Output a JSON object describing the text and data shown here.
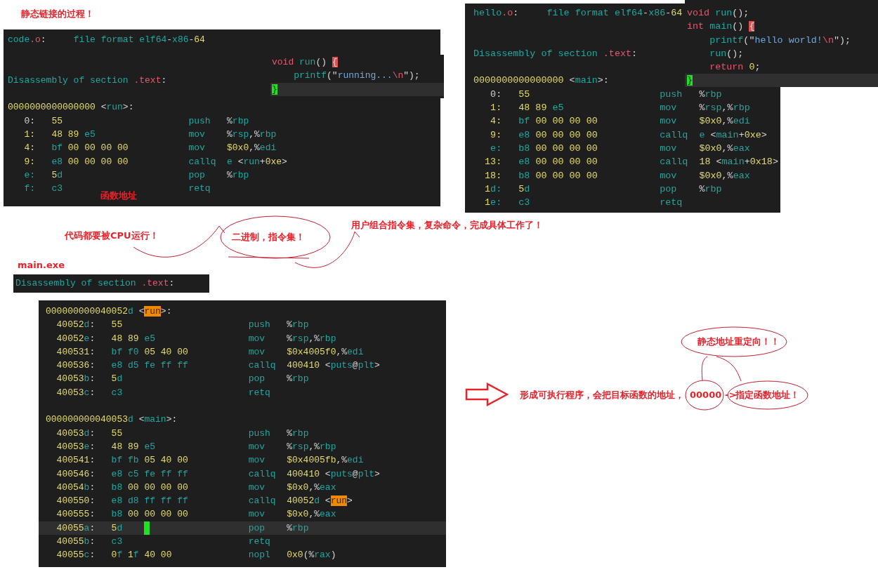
{
  "notes": [
    {
      "text": "静态链接的过程！"
    },
    {
      "text": "函数地址"
    },
    {
      "text": "代码都要被CPU运行！"
    },
    {
      "text": "二进制，指令集！"
    },
    {
      "text": "用户组合指令集，复杂命令，完成具体工作了！"
    },
    {
      "text": "main.exe"
    },
    {
      "text": "静态地址重定向！！"
    },
    {
      "text": "形成可执行程序，会把目标函数的地址，"
    },
    {
      "text": "00000"
    },
    {
      "text": "->"
    },
    {
      "text": "指定函数地址！"
    }
  ],
  "panels": [
    {
      "lines": [
        {
          "kind": "text",
          "current": false,
          "segs": [
            {
              "kind": "name",
              "text": "code"
            },
            {
              "kind": "kw",
              "text": ".o"
            },
            {
              "kind": "plain",
              "text": ":     "
            },
            {
              "kind": "name",
              "text": "file format elf64"
            },
            {
              "kind": "plain",
              "text": "-"
            },
            {
              "kind": "name",
              "text": "x86"
            },
            {
              "kind": "plain",
              "text": "-"
            },
            {
              "kind": "num",
              "text": "64"
            }
          ]
        },
        {
          "kind": "blank",
          "current": false
        },
        {
          "kind": "blank",
          "current": false
        },
        {
          "kind": "text",
          "current": false,
          "segs": [
            {
              "kind": "name",
              "text": "Disassembly of section "
            },
            {
              "kind": "kw",
              "text": ".text"
            },
            {
              "kind": "plain",
              "text": ":"
            }
          ]
        },
        {
          "kind": "blank",
          "current": false
        },
        {
          "kind": "text",
          "current": false,
          "segs": [
            {
              "kind": "num",
              "text": "0000000000000000"
            },
            {
              "kind": "plain",
              "text": " <"
            },
            {
              "kind": "name",
              "text": "run"
            },
            {
              "kind": "plain",
              "text": ">:"
            }
          ]
        },
        {
          "kind": "insn",
          "current": false,
          "cursor": false,
          "addr": [
            {
              "kind": "plain",
              "text": "0:"
            }
          ],
          "bytes": [
            {
              "kind": "num",
              "text": "55"
            }
          ],
          "mnemonic": "push",
          "operands": [
            {
              "kind": "plain",
              "text": "%"
            },
            {
              "kind": "name",
              "text": "rbp"
            }
          ]
        },
        {
          "kind": "insn",
          "current": false,
          "cursor": false,
          "addr": [
            {
              "kind": "num",
              "text": "1:"
            }
          ],
          "bytes": [
            {
              "kind": "num",
              "text": "48 89 "
            },
            {
              "kind": "name",
              "text": "e5"
            }
          ],
          "mnemonic": "mov",
          "operands": [
            {
              "kind": "plain",
              "text": "%"
            },
            {
              "kind": "name",
              "text": "rsp"
            },
            {
              "kind": "plain",
              "text": ",%"
            },
            {
              "kind": "name",
              "text": "rbp"
            }
          ]
        },
        {
          "kind": "insn",
          "current": false,
          "cursor": false,
          "addr": [
            {
              "kind": "num",
              "text": "4:"
            }
          ],
          "bytes": [
            {
              "kind": "name",
              "text": "bf "
            },
            {
              "kind": "num",
              "text": "00 00 00 00"
            }
          ],
          "mnemonic": "mov",
          "operands": [
            {
              "kind": "num",
              "text": "$0x0"
            },
            {
              "kind": "plain",
              "text": ",%"
            },
            {
              "kind": "name",
              "text": "edi"
            }
          ]
        },
        {
          "kind": "insn",
          "current": false,
          "cursor": false,
          "addr": [
            {
              "kind": "num",
              "text": "9:"
            }
          ],
          "bytes": [
            {
              "kind": "name",
              "text": "e8 "
            },
            {
              "kind": "num",
              "text": "00 00 00 00"
            }
          ],
          "mnemonic": "callq",
          "operands": [
            {
              "kind": "name",
              "text": "e "
            },
            {
              "kind": "plain",
              "text": "<"
            },
            {
              "kind": "name",
              "text": "run"
            },
            {
              "kind": "plain",
              "text": "+"
            },
            {
              "kind": "num",
              "text": "0xe"
            },
            {
              "kind": "plain",
              "text": ">"
            }
          ]
        },
        {
          "kind": "insn",
          "current": false,
          "cursor": false,
          "addr": [
            {
              "kind": "name",
              "text": "e:"
            }
          ],
          "bytes": [
            {
              "kind": "num",
              "text": "5"
            },
            {
              "kind": "name",
              "text": "d"
            }
          ],
          "mnemonic": "pop",
          "operands": [
            {
              "kind": "plain",
              "text": "%"
            },
            {
              "kind": "name",
              "text": "rbp"
            }
          ]
        },
        {
          "kind": "insn",
          "current": false,
          "cursor": false,
          "addr": [
            {
              "kind": "name",
              "text": "f:"
            }
          ],
          "bytes": [
            {
              "kind": "name",
              "text": "c3"
            }
          ],
          "mnemonic": "retq"
        }
      ]
    },
    {
      "lines": [
        {
          "kind": "text",
          "current": false,
          "segs": [
            {
              "kind": "kw",
              "text": "void "
            },
            {
              "kind": "name",
              "text": "run"
            },
            {
              "kind": "plain",
              "text": "() "
            },
            {
              "kind": "brace",
              "text": "{"
            }
          ]
        },
        {
          "kind": "indented",
          "current": false,
          "segs": [
            {
              "kind": "name",
              "text": "printf"
            },
            {
              "kind": "plain",
              "text": "(\""
            },
            {
              "kind": "str",
              "text": "running..."
            },
            {
              "kind": "kw",
              "text": "\\n"
            },
            {
              "kind": "plain",
              "text": "\");"
            }
          ]
        },
        {
          "kind": "text",
          "current": true,
          "segs": [
            {
              "kind": "cursor-brace",
              "text": "}"
            }
          ]
        }
      ]
    },
    {
      "lines": [
        {
          "kind": "text",
          "current": false,
          "segs": [
            {
              "kind": "name",
              "text": "hello"
            },
            {
              "kind": "kw",
              "text": ".o"
            },
            {
              "kind": "plain",
              "text": ":     "
            },
            {
              "kind": "name",
              "text": "file format elf64"
            },
            {
              "kind": "plain",
              "text": "-"
            },
            {
              "kind": "name",
              "text": "x86"
            },
            {
              "kind": "plain",
              "text": "-"
            },
            {
              "kind": "num",
              "text": "64"
            }
          ]
        },
        {
          "kind": "blank",
          "current": false
        },
        {
          "kind": "blank",
          "current": false
        },
        {
          "kind": "text",
          "current": false,
          "segs": [
            {
              "kind": "name",
              "text": "Disassembly of section "
            },
            {
              "kind": "kw",
              "text": ".text"
            },
            {
              "kind": "plain",
              "text": ":"
            }
          ]
        },
        {
          "kind": "blank",
          "current": false
        },
        {
          "kind": "text",
          "current": false,
          "segs": [
            {
              "kind": "num",
              "text": "0000000000000000"
            },
            {
              "kind": "plain",
              "text": " <"
            },
            {
              "kind": "name",
              "text": "main"
            },
            {
              "kind": "plain",
              "text": ">:"
            }
          ]
        },
        {
          "kind": "insn",
          "current": false,
          "cursor": false,
          "addr": [
            {
              "kind": "plain",
              "text": "0:"
            }
          ],
          "bytes": [
            {
              "kind": "num",
              "text": "55"
            }
          ],
          "mnemonic": "push",
          "operands": [
            {
              "kind": "plain",
              "text": "%"
            },
            {
              "kind": "name",
              "text": "rbp"
            }
          ]
        },
        {
          "kind": "insn",
          "current": false,
          "cursor": false,
          "addr": [
            {
              "kind": "num",
              "text": "1:"
            }
          ],
          "bytes": [
            {
              "kind": "num",
              "text": "48 89 "
            },
            {
              "kind": "name",
              "text": "e5"
            }
          ],
          "mnemonic": "mov",
          "operands": [
            {
              "kind": "plain",
              "text": "%"
            },
            {
              "kind": "name",
              "text": "rsp"
            },
            {
              "kind": "plain",
              "text": ",%"
            },
            {
              "kind": "name",
              "text": "rbp"
            }
          ]
        },
        {
          "kind": "insn",
          "current": false,
          "cursor": false,
          "addr": [
            {
              "kind": "num",
              "text": "4:"
            }
          ],
          "bytes": [
            {
              "kind": "name",
              "text": "bf "
            },
            {
              "kind": "num",
              "text": "00 00 00 00"
            }
          ],
          "mnemonic": "mov",
          "operands": [
            {
              "kind": "num",
              "text": "$0x0"
            },
            {
              "kind": "plain",
              "text": ",%"
            },
            {
              "kind": "name",
              "text": "edi"
            }
          ]
        },
        {
          "kind": "insn",
          "current": false,
          "cursor": false,
          "addr": [
            {
              "kind": "num",
              "text": "9:"
            }
          ],
          "bytes": [
            {
              "kind": "name",
              "text": "e8 "
            },
            {
              "kind": "num",
              "text": "00 00 00 00"
            }
          ],
          "mnemonic": "callq",
          "operands": [
            {
              "kind": "name",
              "text": "e "
            },
            {
              "kind": "plain",
              "text": "<"
            },
            {
              "kind": "name",
              "text": "main"
            },
            {
              "kind": "plain",
              "text": "+"
            },
            {
              "kind": "num",
              "text": "0xe"
            },
            {
              "kind": "plain",
              "text": ">"
            }
          ]
        },
        {
          "kind": "insn",
          "current": false,
          "cursor": false,
          "addr": [
            {
              "kind": "name",
              "text": "e:"
            }
          ],
          "bytes": [
            {
              "kind": "name",
              "text": "b8 "
            },
            {
              "kind": "num",
              "text": "00 00 00 00"
            }
          ],
          "mnemonic": "mov",
          "operands": [
            {
              "kind": "num",
              "text": "$0x0"
            },
            {
              "kind": "plain",
              "text": ",%"
            },
            {
              "kind": "name",
              "text": "eax"
            }
          ]
        },
        {
          "kind": "insn",
          "current": false,
          "cursor": false,
          "addr": [
            {
              "kind": "num",
              "text": "13:"
            }
          ],
          "bytes": [
            {
              "kind": "name",
              "text": "e8 "
            },
            {
              "kind": "num",
              "text": "00 00 00 00"
            }
          ],
          "mnemonic": "callq",
          "operands": [
            {
              "kind": "num",
              "text": "18 "
            },
            {
              "kind": "plain",
              "text": "<"
            },
            {
              "kind": "name",
              "text": "main"
            },
            {
              "kind": "plain",
              "text": "+"
            },
            {
              "kind": "num",
              "text": "0x18"
            },
            {
              "kind": "plain",
              "text": ">"
            }
          ]
        },
        {
          "kind": "insn",
          "current": false,
          "cursor": false,
          "addr": [
            {
              "kind": "num",
              "text": "18:"
            }
          ],
          "bytes": [
            {
              "kind": "name",
              "text": "b8 "
            },
            {
              "kind": "num",
              "text": "00 00 00 00"
            }
          ],
          "mnemonic": "mov",
          "operands": [
            {
              "kind": "num",
              "text": "$0x0"
            },
            {
              "kind": "plain",
              "text": ",%"
            },
            {
              "kind": "name",
              "text": "eax"
            }
          ]
        },
        {
          "kind": "insn",
          "current": false,
          "cursor": false,
          "addr": [
            {
              "kind": "num",
              "text": "1"
            },
            {
              "kind": "name",
              "text": "d:"
            }
          ],
          "bytes": [
            {
              "kind": "num",
              "text": "5"
            },
            {
              "kind": "name",
              "text": "d"
            }
          ],
          "mnemonic": "pop",
          "operands": [
            {
              "kind": "plain",
              "text": "%"
            },
            {
              "kind": "name",
              "text": "rbp"
            }
          ]
        },
        {
          "kind": "insn",
          "current": false,
          "cursor": false,
          "addr": [
            {
              "kind": "num",
              "text": "1"
            },
            {
              "kind": "name",
              "text": "e:"
            }
          ],
          "bytes": [
            {
              "kind": "name",
              "text": "c3"
            }
          ],
          "mnemonic": "retq"
        }
      ]
    },
    {
      "lines": [
        {
          "kind": "text",
          "current": false,
          "segs": [
            {
              "kind": "kw",
              "text": "void "
            },
            {
              "kind": "name",
              "text": "run"
            },
            {
              "kind": "plain",
              "text": "();"
            }
          ]
        },
        {
          "kind": "text",
          "current": false,
          "segs": [
            {
              "kind": "kw",
              "text": "int "
            },
            {
              "kind": "name",
              "text": "main"
            },
            {
              "kind": "plain",
              "text": "() "
            },
            {
              "kind": "brace",
              "text": "{"
            }
          ]
        },
        {
          "kind": "indented",
          "current": false,
          "segs": [
            {
              "kind": "name",
              "text": "printf"
            },
            {
              "kind": "plain",
              "text": "(\""
            },
            {
              "kind": "str",
              "text": "hello world!"
            },
            {
              "kind": "kw",
              "text": "\\n"
            },
            {
              "kind": "plain",
              "text": "\");"
            }
          ]
        },
        {
          "kind": "indented",
          "current": false,
          "segs": [
            {
              "kind": "name",
              "text": "run"
            },
            {
              "kind": "plain",
              "text": "();"
            }
          ]
        },
        {
          "kind": "indented",
          "current": false,
          "segs": [
            {
              "kind": "kw",
              "text": "return "
            },
            {
              "kind": "num",
              "text": "0"
            },
            {
              "kind": "plain",
              "text": ";"
            }
          ]
        },
        {
          "kind": "text",
          "current": true,
          "segs": [
            {
              "kind": "cursor-brace",
              "text": "}"
            }
          ]
        }
      ]
    },
    {
      "lines": [
        {
          "kind": "text",
          "current": false,
          "segs": [
            {
              "kind": "name",
              "text": "Disassembly of section "
            },
            {
              "kind": "kw",
              "text": ".text"
            },
            {
              "kind": "plain",
              "text": ":"
            }
          ]
        }
      ]
    },
    {
      "lines": [
        {
          "kind": "text",
          "current": false,
          "segs": [
            {
              "kind": "num",
              "text": "000000000040052"
            },
            {
              "kind": "name",
              "text": "d"
            },
            {
              "kind": "plain",
              "text": " <"
            },
            {
              "kind": "match",
              "text": "run"
            },
            {
              "kind": "plain",
              "text": ">:"
            }
          ]
        },
        {
          "kind": "insn",
          "current": false,
          "cursor": false,
          "addr": [
            {
              "kind": "num",
              "text": "40052"
            },
            {
              "kind": "name",
              "text": "d"
            },
            {
              "kind": "plain",
              "text": ":"
            }
          ],
          "bytes": [
            {
              "kind": "num",
              "text": "55"
            }
          ],
          "mnemonic": "push",
          "operands": [
            {
              "kind": "plain",
              "text": "%"
            },
            {
              "kind": "name",
              "text": "rbp"
            }
          ]
        },
        {
          "kind": "insn",
          "current": false,
          "cursor": false,
          "addr": [
            {
              "kind": "num",
              "text": "40052"
            },
            {
              "kind": "name",
              "text": "e"
            },
            {
              "kind": "plain",
              "text": ":"
            }
          ],
          "bytes": [
            {
              "kind": "num",
              "text": "48 89 "
            },
            {
              "kind": "name",
              "text": "e5"
            }
          ],
          "mnemonic": "mov",
          "operands": [
            {
              "kind": "plain",
              "text": "%"
            },
            {
              "kind": "name",
              "text": "rsp"
            },
            {
              "kind": "plain",
              "text": ",%"
            },
            {
              "kind": "name",
              "text": "rbp"
            }
          ]
        },
        {
          "kind": "insn",
          "current": false,
          "cursor": false,
          "addr": [
            {
              "kind": "num",
              "text": "400531"
            },
            {
              "kind": "plain",
              "text": ":"
            }
          ],
          "bytes": [
            {
              "kind": "name",
              "text": "bf f0 "
            },
            {
              "kind": "num",
              "text": "05 40 00"
            }
          ],
          "mnemonic": "mov",
          "operands": [
            {
              "kind": "num",
              "text": "$0x4005f0"
            },
            {
              "kind": "plain",
              "text": ",%"
            },
            {
              "kind": "name",
              "text": "edi"
            }
          ]
        },
        {
          "kind": "insn",
          "current": false,
          "cursor": false,
          "addr": [
            {
              "kind": "num",
              "text": "400536"
            },
            {
              "kind": "plain",
              "text": ":"
            }
          ],
          "bytes": [
            {
              "kind": "name",
              "text": "e8 d5 fe ff ff"
            }
          ],
          "mnemonic": "callq",
          "operands": [
            {
              "kind": "num",
              "text": "400410 "
            },
            {
              "kind": "plain",
              "text": "<"
            },
            {
              "kind": "name",
              "text": "puts"
            },
            {
              "kind": "plain",
              "text": "@"
            },
            {
              "kind": "name",
              "text": "plt"
            },
            {
              "kind": "plain",
              "text": ">"
            }
          ]
        },
        {
          "kind": "insn",
          "current": false,
          "cursor": false,
          "addr": [
            {
              "kind": "num",
              "text": "40053"
            },
            {
              "kind": "name",
              "text": "b"
            },
            {
              "kind": "plain",
              "text": ":"
            }
          ],
          "bytes": [
            {
              "kind": "num",
              "text": "5"
            },
            {
              "kind": "name",
              "text": "d"
            }
          ],
          "mnemonic": "pop",
          "operands": [
            {
              "kind": "plain",
              "text": "%"
            },
            {
              "kind": "name",
              "text": "rbp"
            }
          ]
        },
        {
          "kind": "insn",
          "current": false,
          "cursor": false,
          "addr": [
            {
              "kind": "num",
              "text": "40053"
            },
            {
              "kind": "name",
              "text": "c"
            },
            {
              "kind": "plain",
              "text": ":"
            }
          ],
          "bytes": [
            {
              "kind": "name",
              "text": "c3"
            }
          ],
          "mnemonic": "retq"
        },
        {
          "kind": "blank",
          "current": false
        },
        {
          "kind": "text",
          "current": false,
          "segs": [
            {
              "kind": "num",
              "text": "000000000040053"
            },
            {
              "kind": "name",
              "text": "d"
            },
            {
              "kind": "plain",
              "text": " <"
            },
            {
              "kind": "name",
              "text": "main"
            },
            {
              "kind": "plain",
              "text": ">:"
            }
          ]
        },
        {
          "kind": "insn",
          "current": false,
          "cursor": false,
          "addr": [
            {
              "kind": "num",
              "text": "40053"
            },
            {
              "kind": "name",
              "text": "d"
            },
            {
              "kind": "plain",
              "text": ":"
            }
          ],
          "bytes": [
            {
              "kind": "num",
              "text": "55"
            }
          ],
          "mnemonic": "push",
          "operands": [
            {
              "kind": "plain",
              "text": "%"
            },
            {
              "kind": "name",
              "text": "rbp"
            }
          ]
        },
        {
          "kind": "insn",
          "current": false,
          "cursor": false,
          "addr": [
            {
              "kind": "num",
              "text": "40053"
            },
            {
              "kind": "name",
              "text": "e"
            },
            {
              "kind": "plain",
              "text": ":"
            }
          ],
          "bytes": [
            {
              "kind": "num",
              "text": "48 89 "
            },
            {
              "kind": "name",
              "text": "e5"
            }
          ],
          "mnemonic": "mov",
          "operands": [
            {
              "kind": "plain",
              "text": "%"
            },
            {
              "kind": "name",
              "text": "rsp"
            },
            {
              "kind": "plain",
              "text": ",%"
            },
            {
              "kind": "name",
              "text": "rbp"
            }
          ]
        },
        {
          "kind": "insn",
          "current": false,
          "cursor": false,
          "addr": [
            {
              "kind": "num",
              "text": "400541"
            },
            {
              "kind": "plain",
              "text": ":"
            }
          ],
          "bytes": [
            {
              "kind": "name",
              "text": "bf fb "
            },
            {
              "kind": "num",
              "text": "05 40 00"
            }
          ],
          "mnemonic": "mov",
          "operands": [
            {
              "kind": "num",
              "text": "$0x4005fb"
            },
            {
              "kind": "plain",
              "text": ",%"
            },
            {
              "kind": "name",
              "text": "edi"
            }
          ]
        },
        {
          "kind": "insn",
          "current": false,
          "cursor": false,
          "addr": [
            {
              "kind": "num",
              "text": "400546"
            },
            {
              "kind": "plain",
              "text": ":"
            }
          ],
          "bytes": [
            {
              "kind": "name",
              "text": "e8 c5 fe ff ff"
            }
          ],
          "mnemonic": "callq",
          "operands": [
            {
              "kind": "num",
              "text": "400410 "
            },
            {
              "kind": "plain",
              "text": "<"
            },
            {
              "kind": "name",
              "text": "puts"
            },
            {
              "kind": "plain",
              "text": "@"
            },
            {
              "kind": "name",
              "text": "plt"
            },
            {
              "kind": "plain",
              "text": ">"
            }
          ]
        },
        {
          "kind": "insn",
          "current": false,
          "cursor": false,
          "addr": [
            {
              "kind": "num",
              "text": "40054"
            },
            {
              "kind": "name",
              "text": "b"
            },
            {
              "kind": "plain",
              "text": ":"
            }
          ],
          "bytes": [
            {
              "kind": "name",
              "text": "b8 "
            },
            {
              "kind": "num",
              "text": "00 00 00 00"
            }
          ],
          "mnemonic": "mov",
          "operands": [
            {
              "kind": "num",
              "text": "$0x0"
            },
            {
              "kind": "plain",
              "text": ",%"
            },
            {
              "kind": "name",
              "text": "eax"
            }
          ]
        },
        {
          "kind": "insn",
          "current": false,
          "cursor": false,
          "addr": [
            {
              "kind": "num",
              "text": "400550"
            },
            {
              "kind": "plain",
              "text": ":"
            }
          ],
          "bytes": [
            {
              "kind": "name",
              "text": "e8 d8 ff ff ff"
            }
          ],
          "mnemonic": "callq",
          "operands": [
            {
              "kind": "num",
              "text": "40052"
            },
            {
              "kind": "name",
              "text": "d"
            },
            {
              "kind": "plain",
              "text": " <"
            },
            {
              "kind": "match",
              "text": "run"
            },
            {
              "kind": "plain",
              "text": ">"
            }
          ]
        },
        {
          "kind": "insn",
          "current": false,
          "cursor": false,
          "addr": [
            {
              "kind": "num",
              "text": "400555"
            },
            {
              "kind": "plain",
              "text": ":"
            }
          ],
          "bytes": [
            {
              "kind": "name",
              "text": "b8 "
            },
            {
              "kind": "num",
              "text": "00 00 00 00"
            }
          ],
          "mnemonic": "mov",
          "operands": [
            {
              "kind": "num",
              "text": "$0x0"
            },
            {
              "kind": "plain",
              "text": ",%"
            },
            {
              "kind": "name",
              "text": "eax"
            }
          ]
        },
        {
          "kind": "insn",
          "current": true,
          "cursor": true,
          "addr": [
            {
              "kind": "num",
              "text": "40055"
            },
            {
              "kind": "name",
              "text": "a"
            },
            {
              "kind": "plain",
              "text": ":"
            }
          ],
          "bytes": [
            {
              "kind": "num",
              "text": "5"
            },
            {
              "kind": "name",
              "text": "d"
            }
          ],
          "mnemonic": "pop",
          "operands": [
            {
              "kind": "plain",
              "text": "%"
            },
            {
              "kind": "name",
              "text": "rbp"
            }
          ]
        },
        {
          "kind": "insn",
          "current": false,
          "cursor": false,
          "addr": [
            {
              "kind": "num",
              "text": "40055"
            },
            {
              "kind": "name",
              "text": "b"
            },
            {
              "kind": "plain",
              "text": ":"
            }
          ],
          "bytes": [
            {
              "kind": "name",
              "text": "c3"
            }
          ],
          "mnemonic": "retq"
        },
        {
          "kind": "insn",
          "current": false,
          "cursor": false,
          "addr": [
            {
              "kind": "num",
              "text": "40055"
            },
            {
              "kind": "name",
              "text": "c"
            },
            {
              "kind": "plain",
              "text": ":"
            }
          ],
          "bytes": [
            {
              "kind": "num",
              "text": "0"
            },
            {
              "kind": "name",
              "text": "f "
            },
            {
              "kind": "num",
              "text": "1"
            },
            {
              "kind": "name",
              "text": "f "
            },
            {
              "kind": "num",
              "text": "40 00"
            }
          ],
          "mnemonic": "nopl",
          "operands": [
            {
              "kind": "num",
              "text": "0x0"
            },
            {
              "kind": "plain",
              "text": "(%"
            },
            {
              "kind": "name",
              "text": "rax"
            },
            {
              "kind": "plain",
              "text": ")"
            }
          ]
        }
      ]
    }
  ]
}
